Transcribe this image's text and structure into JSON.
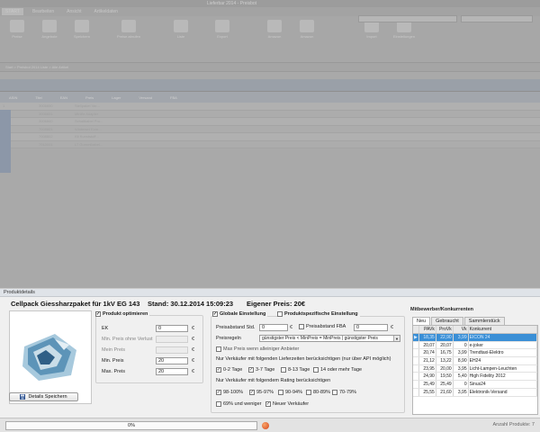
{
  "background": {
    "window_title": "Lieferbar 2014 - Preisbot",
    "tabs": [
      "START",
      "Bearbeiten",
      "Ansicht",
      "Artikeldaten"
    ],
    "search_placeholder": "Suche",
    "ribbon": [
      "Preise",
      "Angebote",
      "Speichern",
      "Preise abrufen",
      "Liste",
      "Export",
      "Amazon",
      "Amazon",
      "Import",
      "Einstellungen"
    ],
    "breadcrumb": "Start  >  Preisbot 2014 Liste  >  Alle Artikel",
    "grid_columns": [
      "",
      "ASIN",
      "Titel",
      "EAN",
      "Preis",
      "Lager",
      "Versand",
      "FBA"
    ],
    "grid_rows": [
      [
        "1",
        "3006650",
        "Stellpaket Ver..."
      ],
      [
        "2",
        "3006651",
        "Minifix Adapter"
      ],
      [
        "3",
        "3006660",
        "Schaltkabel Pro..."
      ],
      [
        "4",
        "7008801",
        "Winterset Kom..."
      ],
      [
        "5",
        "7008802",
        "Kit Kunststoff..."
      ],
      [
        "6",
        "7010001",
        "LT Gummikabel..."
      ]
    ]
  },
  "details": {
    "panel_title": "Produktdetails",
    "product_name": "Cellpack Giessharzpaket für 1kV EG 143",
    "stand": "Stand: 30.12.2014 15:09:23",
    "own_price": "Eigener Preis: 20€",
    "save_button": "Details Speichern",
    "optimize": {
      "label": "Produkt optimieren",
      "checked": true,
      "fields": [
        {
          "label": "EK",
          "value": "0",
          "enabled": true
        },
        {
          "label": "Min. Preis ohne Verlust",
          "value": "",
          "enabled": false
        },
        {
          "label": "Mein Preis",
          "value": "",
          "enabled": false
        },
        {
          "label": "Min. Preis",
          "value": "20",
          "enabled": true
        },
        {
          "label": "Max. Preis",
          "value": "20",
          "enabled": true
        }
      ],
      "currency": "€"
    },
    "settings": {
      "global_label": "Globale Einstellung",
      "global_checked": true,
      "specific_label": "Produktspezifische Einstellung",
      "specific_checked": false,
      "abstand_std_label": "Preisabstand Std.",
      "abstand_std_value": "0",
      "abstand_fba_label": "Preisabstand FBA",
      "abstand_fba_value": "0",
      "preisregeln_label": "Preisregeln",
      "preisregeln_value": "günstigster Preis < MinPreis = MinPreis | günstigster Preis",
      "max_price_label": "Max Preis wenn alleiniger Anbieter",
      "lieferzeiten_label": "Nur Verkäufer mit folgenden Lieferzeiten berücksichtigen (nur über API möglich)",
      "delivery": [
        {
          "label": "0-2 Tage",
          "checked": true
        },
        {
          "label": "3-7 Tage",
          "checked": true
        },
        {
          "label": "8-13 Tage",
          "checked": false
        },
        {
          "label": "14 oder mehr Tage",
          "checked": false
        }
      ],
      "rating_label": "Nur Verkäufer mit folgendem Rating berücksichtigen",
      "ratings": [
        {
          "label": "98-100%",
          "checked": true
        },
        {
          "label": "95-97%",
          "checked": true
        },
        {
          "label": "90-94%",
          "checked": false
        },
        {
          "label": "80-89%",
          "checked": false
        },
        {
          "label": "70-79%",
          "checked": false
        },
        {
          "label": "69% und weniger",
          "checked": false
        },
        {
          "label": "Neuer Verkäufer",
          "checked": true
        }
      ]
    },
    "competitors": {
      "title": "Mitbewerber/Konkurrenten",
      "tabs": [
        "Neu",
        "Gebraucht",
        "Sammlerstück"
      ],
      "active_tab": "Neu",
      "columns": [
        "",
        "PAVk",
        "ProVk",
        "Vk",
        "Konkurrent"
      ],
      "rows": [
        {
          "pavk": "18,35",
          "provk": "22,90",
          "vk": "3,99",
          "name": "EICON 24",
          "selected": true
        },
        {
          "pavk": "20,07",
          "provk": "20,07",
          "vk": "0",
          "name": "e-joker"
        },
        {
          "pavk": "20,74",
          "provk": "16,75",
          "vk": "3,99",
          "name": "Trendtaxi-Elektro"
        },
        {
          "pavk": "21,12",
          "provk": "13,22",
          "vk": "8,90",
          "name": "EH24"
        },
        {
          "pavk": "23,95",
          "provk": "20,00",
          "vk": "3,95",
          "name": "Licht-Lampen-Leuchten"
        },
        {
          "pavk": "24,90",
          "provk": "19,50",
          "vk": "5,40",
          "name": "High Fidelity 2012"
        },
        {
          "pavk": "25,49",
          "provk": "25,49",
          "vk": "0",
          "name": "Sinus24"
        },
        {
          "pavk": "25,55",
          "provk": "21,60",
          "vk": "3,95",
          "name": "Elektronik-Versand"
        }
      ]
    }
  },
  "status": {
    "progress_text": "0%",
    "progress": 0,
    "count_label": "Anzahl Produkte: 7"
  }
}
